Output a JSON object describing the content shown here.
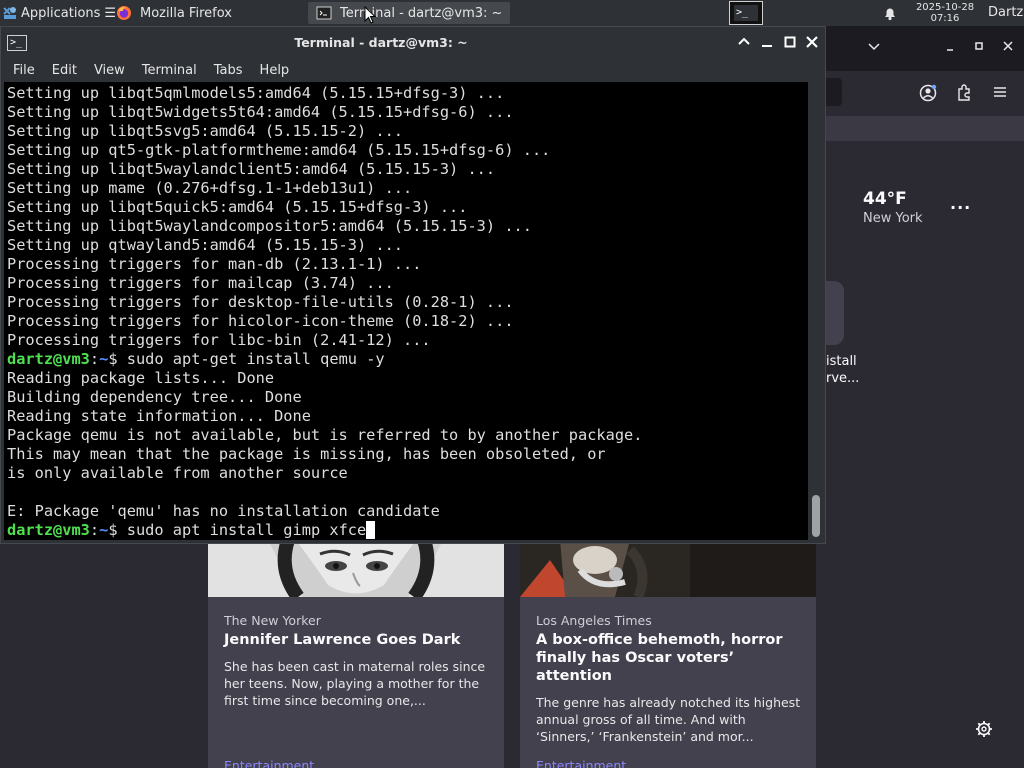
{
  "panel": {
    "applications_label": "Applications",
    "applications_suffix": "☰",
    "tasks": [
      {
        "label": "Mozilla Firefox"
      },
      {
        "label": "Terminal - dartz@vm3: ~"
      }
    ],
    "clock_date": "2025-10-28",
    "clock_time": "07:16",
    "user": "Dartz"
  },
  "firefox": {
    "weather": {
      "temp": "44°F",
      "city": "New York",
      "more": "···"
    },
    "shortcut_label_line1": "istall",
    "shortcut_label_line2": "rve...",
    "cards": [
      {
        "source": "The New Yorker",
        "title": "Jennifer Lawrence Goes Dark",
        "description": "She has been cast in maternal roles since her teens. Now, playing a mother for the first time since becoming one,...",
        "category": "Entertainment"
      },
      {
        "source": "Los Angeles Times",
        "title": "A box-office behemoth, horror finally has Oscar voters’ attention",
        "description": "The genre has already notched its highest annual gross of all time. And with ‘Sinners,’ ‘Frankenstein’ and mor...",
        "category": "Entertainment"
      }
    ]
  },
  "terminal": {
    "title": "Terminal - dartz@vm3: ~",
    "menu": [
      "File",
      "Edit",
      "View",
      "Terminal",
      "Tabs",
      "Help"
    ],
    "lines": [
      "Setting up libqt5qmlmodels5:amd64 (5.15.15+dfsg-3) ...",
      "Setting up libqt5widgets5t64:amd64 (5.15.15+dfsg-6) ...",
      "Setting up libqt5svg5:amd64 (5.15.15-2) ...",
      "Setting up qt5-gtk-platformtheme:amd64 (5.15.15+dfsg-6) ...",
      "Setting up libqt5waylandclient5:amd64 (5.15.15-3) ...",
      "Setting up mame (0.276+dfsg.1-1+deb13u1) ...",
      "Setting up libqt5quick5:amd64 (5.15.15+dfsg-3) ...",
      "Setting up libqt5waylandcompositor5:amd64 (5.15.15-3) ...",
      "Setting up qtwayland5:amd64 (5.15.15-3) ...",
      "Processing triggers for man-db (2.13.1-1) ...",
      "Processing triggers for mailcap (3.74) ...",
      "Processing triggers for desktop-file-utils (0.28-1) ...",
      "Processing triggers for hicolor-icon-theme (0.18-2) ...",
      "Processing triggers for libc-bin (2.41-12) ..."
    ],
    "prompt_user": "dartz@vm3",
    "prompt_sep": ":",
    "prompt_path": "~",
    "prompt_sign": "$ ",
    "command1": "sudo apt-get install qemu -y",
    "output2": [
      "Reading package lists... Done",
      "Building dependency tree... Done",
      "Reading state information... Done",
      "Package qemu is not available, but is referred to by another package.",
      "This may mean that the package is missing, has been obsoleted, or",
      "is only available from another source",
      "",
      "E: Package 'qemu' has no installation candidate"
    ],
    "command2": "sudo apt install gimp xfce"
  }
}
